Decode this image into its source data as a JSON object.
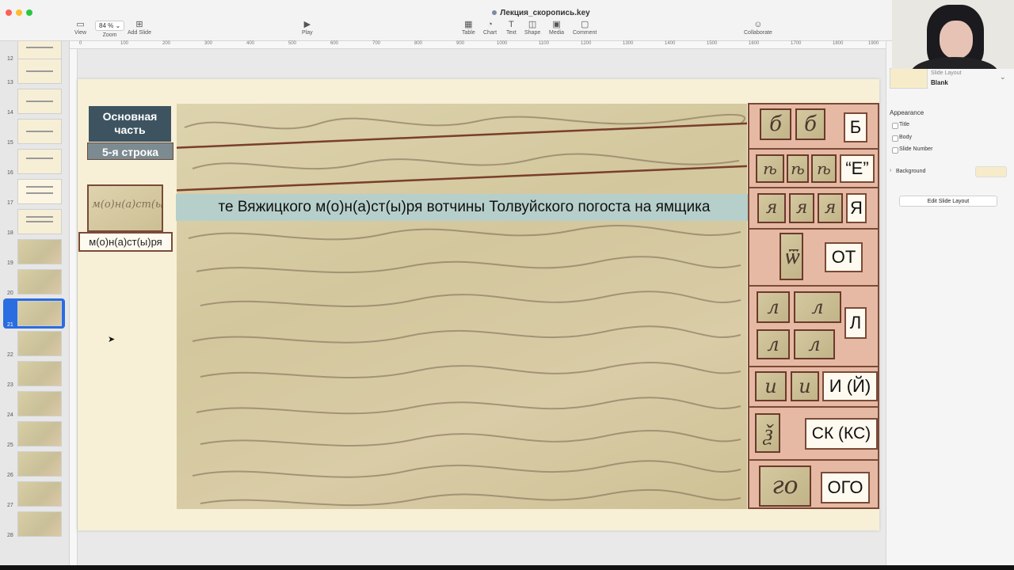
{
  "window": {
    "title": "Лекция_скоропись.key"
  },
  "toolbar": {
    "view": "View",
    "zoom_value": "84 %",
    "zoom": "Zoom",
    "add_slide": "Add Slide",
    "play": "Play",
    "table": "Table",
    "chart": "Chart",
    "text": "Text",
    "shape": "Shape",
    "media": "Media",
    "comment": "Comment",
    "collaborate": "Collaborate"
  },
  "sidebar": {
    "slide_numbers": [
      "12",
      "13",
      "14",
      "15",
      "16",
      "17",
      "18",
      "19",
      "20",
      "21",
      "22",
      "23",
      "24",
      "25",
      "26",
      "27",
      "28"
    ],
    "selected": "21"
  },
  "ruler": {
    "ticks": [
      "0",
      "100",
      "200",
      "300",
      "400",
      "500",
      "600",
      "700",
      "800",
      "900",
      "1000",
      "1100",
      "1200",
      "1300",
      "1400",
      "1500",
      "1600",
      "1700",
      "1800",
      "1900"
    ]
  },
  "slide": {
    "section_label": "Основная часть",
    "row_label": "5-я строка",
    "word_crop": "м(о)н(а)ст(ы)ря",
    "word_label": "м(о)н(а)ст(ы)ря",
    "transliteration": "те Вяжицкого м(о)н(а)ст(ы)ря вотчины Толвуйского погоста на ямщика",
    "letters": [
      "Б",
      "“Е”",
      "Я",
      "ОТ",
      "Л",
      "И (Й)",
      "СК (КС)",
      "ОГО"
    ]
  },
  "inspector": {
    "layout_caption": "Slide Layout",
    "layout_name": "Blank",
    "appearance": "Appearance",
    "title": "Title",
    "body": "Body",
    "slide_number": "Slide Number",
    "background": "Background",
    "edit_layout": "Edit Slide Layout"
  },
  "colors": {
    "accent_selected": "#2a6de0",
    "slide_bg": "#f7f0d7",
    "panel": "#e6b9a4",
    "border": "#7a4a37",
    "translit_bar": "#b6cfcb",
    "label_dark": "#3d5460"
  }
}
